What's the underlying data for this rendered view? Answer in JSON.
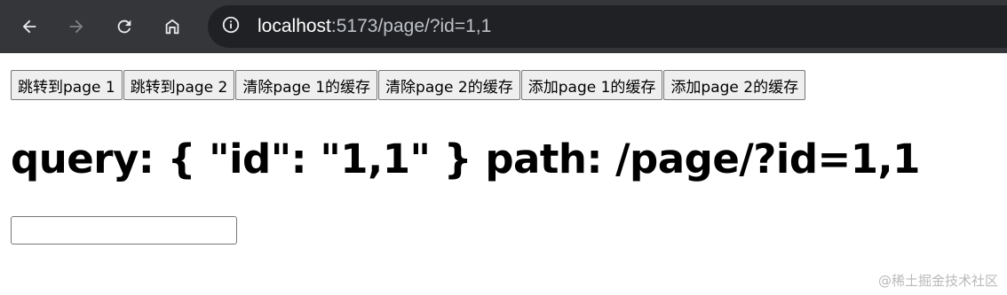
{
  "browser": {
    "url_host": "localhost",
    "url_rest": ":5173/page/?id=1,1",
    "icons": {
      "back": "arrow-left-icon",
      "forward": "arrow-right-icon",
      "reload": "reload-icon",
      "home": "home-icon",
      "site_info": "info-icon"
    }
  },
  "page": {
    "buttons": [
      {
        "label": "跳转到page 1"
      },
      {
        "label": "跳转到page 2"
      },
      {
        "label": "清除page 1的缓存"
      },
      {
        "label": "清除page 2的缓存"
      },
      {
        "label": "添加page 1的缓存"
      },
      {
        "label": "添加page 2的缓存"
      }
    ],
    "heading": "query: { \"id\": \"1,1\" } path: /page/?id=1,1",
    "input": {
      "value": "",
      "placeholder": ""
    }
  },
  "watermark": "@稀土掘金技术社区"
}
